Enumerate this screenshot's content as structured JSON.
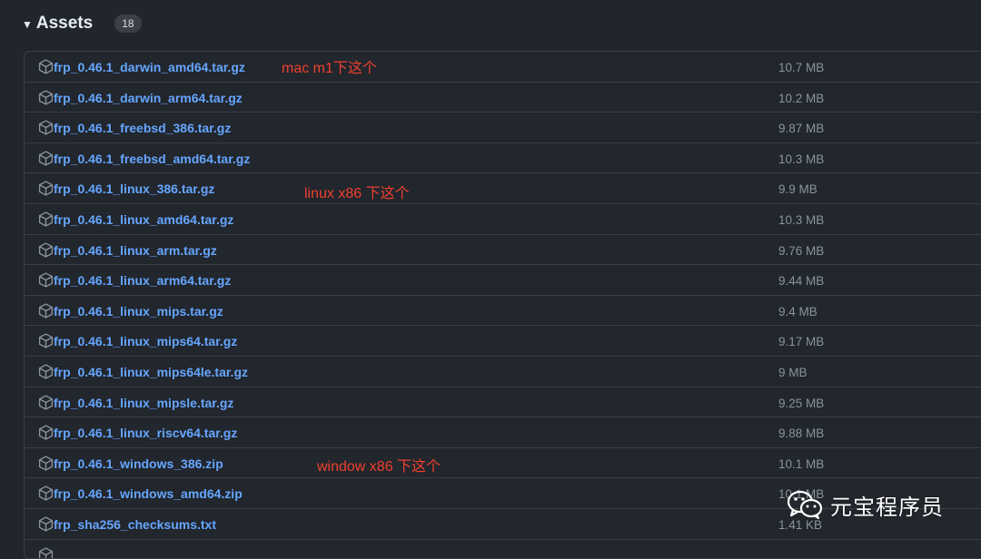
{
  "header": {
    "title": "Assets",
    "count": "18"
  },
  "assets": [
    {
      "name": "frp_0.46.1_darwin_amd64.tar.gz",
      "size": "10.7 MB"
    },
    {
      "name": "frp_0.46.1_darwin_arm64.tar.gz",
      "size": "10.2 MB"
    },
    {
      "name": "frp_0.46.1_freebsd_386.tar.gz",
      "size": "9.87 MB"
    },
    {
      "name": "frp_0.46.1_freebsd_amd64.tar.gz",
      "size": "10.3 MB"
    },
    {
      "name": "frp_0.46.1_linux_386.tar.gz",
      "size": "9.9 MB"
    },
    {
      "name": "frp_0.46.1_linux_amd64.tar.gz",
      "size": "10.3 MB"
    },
    {
      "name": "frp_0.46.1_linux_arm.tar.gz",
      "size": "9.76 MB"
    },
    {
      "name": "frp_0.46.1_linux_arm64.tar.gz",
      "size": "9.44 MB"
    },
    {
      "name": "frp_0.46.1_linux_mips.tar.gz",
      "size": "9.4 MB"
    },
    {
      "name": "frp_0.46.1_linux_mips64.tar.gz",
      "size": "9.17 MB"
    },
    {
      "name": "frp_0.46.1_linux_mips64le.tar.gz",
      "size": "9 MB"
    },
    {
      "name": "frp_0.46.1_linux_mipsle.tar.gz",
      "size": "9.25 MB"
    },
    {
      "name": "frp_0.46.1_linux_riscv64.tar.gz",
      "size": "9.88 MB"
    },
    {
      "name": "frp_0.46.1_windows_386.zip",
      "size": "10.1 MB"
    },
    {
      "name": "frp_0.46.1_windows_amd64.zip",
      "size": "10.1 MB"
    },
    {
      "name": "frp_sha256_checksums.txt",
      "size": "1.41 KB"
    },
    {
      "name": "",
      "size": ""
    }
  ],
  "annotations": {
    "mac": "mac m1下这个",
    "linux": "linux x86 下这个",
    "windows": "window x86 下这个"
  },
  "watermark": {
    "text": "元宝程序员",
    "icon": "wechat-icon"
  },
  "colors": {
    "link": "#65a6ff",
    "annotation": "#f0402e",
    "size_text": "#8b949e"
  }
}
